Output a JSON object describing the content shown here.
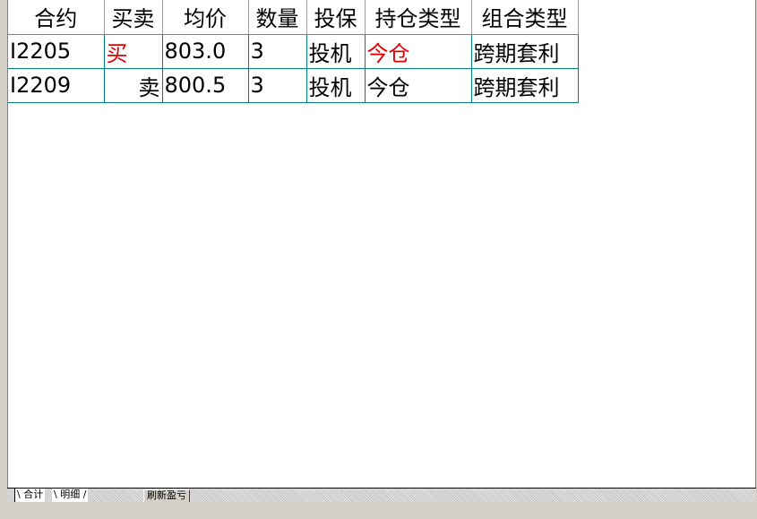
{
  "table": {
    "headers": [
      "合约",
      "买卖",
      "均价",
      "数量",
      "投保",
      "持仓类型",
      "组合类型"
    ],
    "rows": [
      {
        "contract": "I2205",
        "side": "买",
        "avg_price": "803.0",
        "qty": "3",
        "hedge": "投机",
        "position_type": "今仓",
        "combo_type": "跨期套利"
      },
      {
        "contract": "I2209",
        "side": "卖",
        "avg_price": "800.5",
        "qty": "3",
        "hedge": "投机",
        "position_type": "今仓",
        "combo_type": "跨期套利"
      }
    ]
  },
  "tabs": {
    "summary": "合计",
    "detail": "明细"
  },
  "refresh_button": "刷新盈亏",
  "colors": {
    "buy": "#e00000",
    "grid_line": "#008080"
  }
}
